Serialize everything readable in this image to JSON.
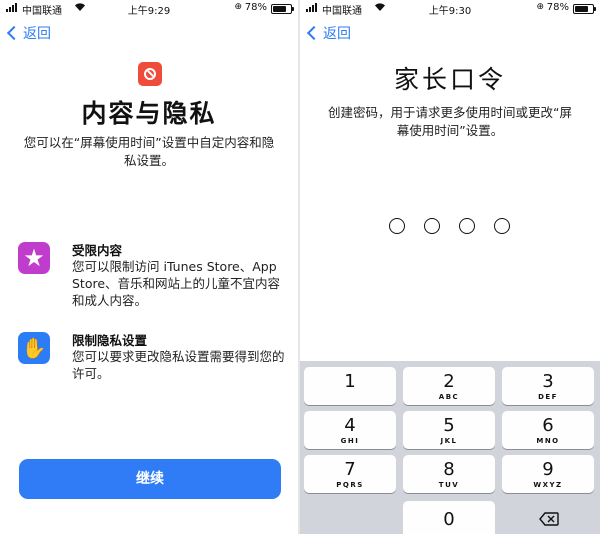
{
  "left_screen": {
    "status": {
      "carrier": "中国联通",
      "time": "上午9:29",
      "battery": "78%",
      "battery_level": 0.78
    },
    "back_label": "返回",
    "title": "内容与隐私",
    "description": "您可以在“屏幕使用时间”设置中自定内容和隐私设置。",
    "features": [
      {
        "title": "受限内容",
        "body": "您可以限制访问 iTunes Store、App Store、音乐和网站上的儿童不宜内容和成人内容。",
        "icon": "star-icon",
        "color": "#c03ccd"
      },
      {
        "title": "限制隐私设置",
        "body": "您可以要求更改隐私设置需要得到您的许可。",
        "icon": "hand-icon",
        "color": "#2c7cf6"
      }
    ],
    "continue_label": "继续",
    "icon": "restriction-icon",
    "accent": "#2f7cf6"
  },
  "right_screen": {
    "status": {
      "carrier": "中国联通",
      "time": "上午9:30",
      "battery": "78%",
      "battery_level": 0.78
    },
    "back_label": "返回",
    "title": "家长口令",
    "description": "创建密码，用于请求更多使用时间或更改“屏幕使用时间”设置。",
    "passcode_length": 4,
    "keypad": [
      {
        "num": "1",
        "letters": ""
      },
      {
        "num": "2",
        "letters": "ABC"
      },
      {
        "num": "3",
        "letters": "DEF"
      },
      {
        "num": "4",
        "letters": "GHI"
      },
      {
        "num": "5",
        "letters": "JKL"
      },
      {
        "num": "6",
        "letters": "MNO"
      },
      {
        "num": "7",
        "letters": "PQRS"
      },
      {
        "num": "8",
        "letters": "TUV"
      },
      {
        "num": "9",
        "letters": "WXYZ"
      },
      {
        "num": "0",
        "letters": ""
      }
    ],
    "backspace_icon": "backspace-icon"
  }
}
